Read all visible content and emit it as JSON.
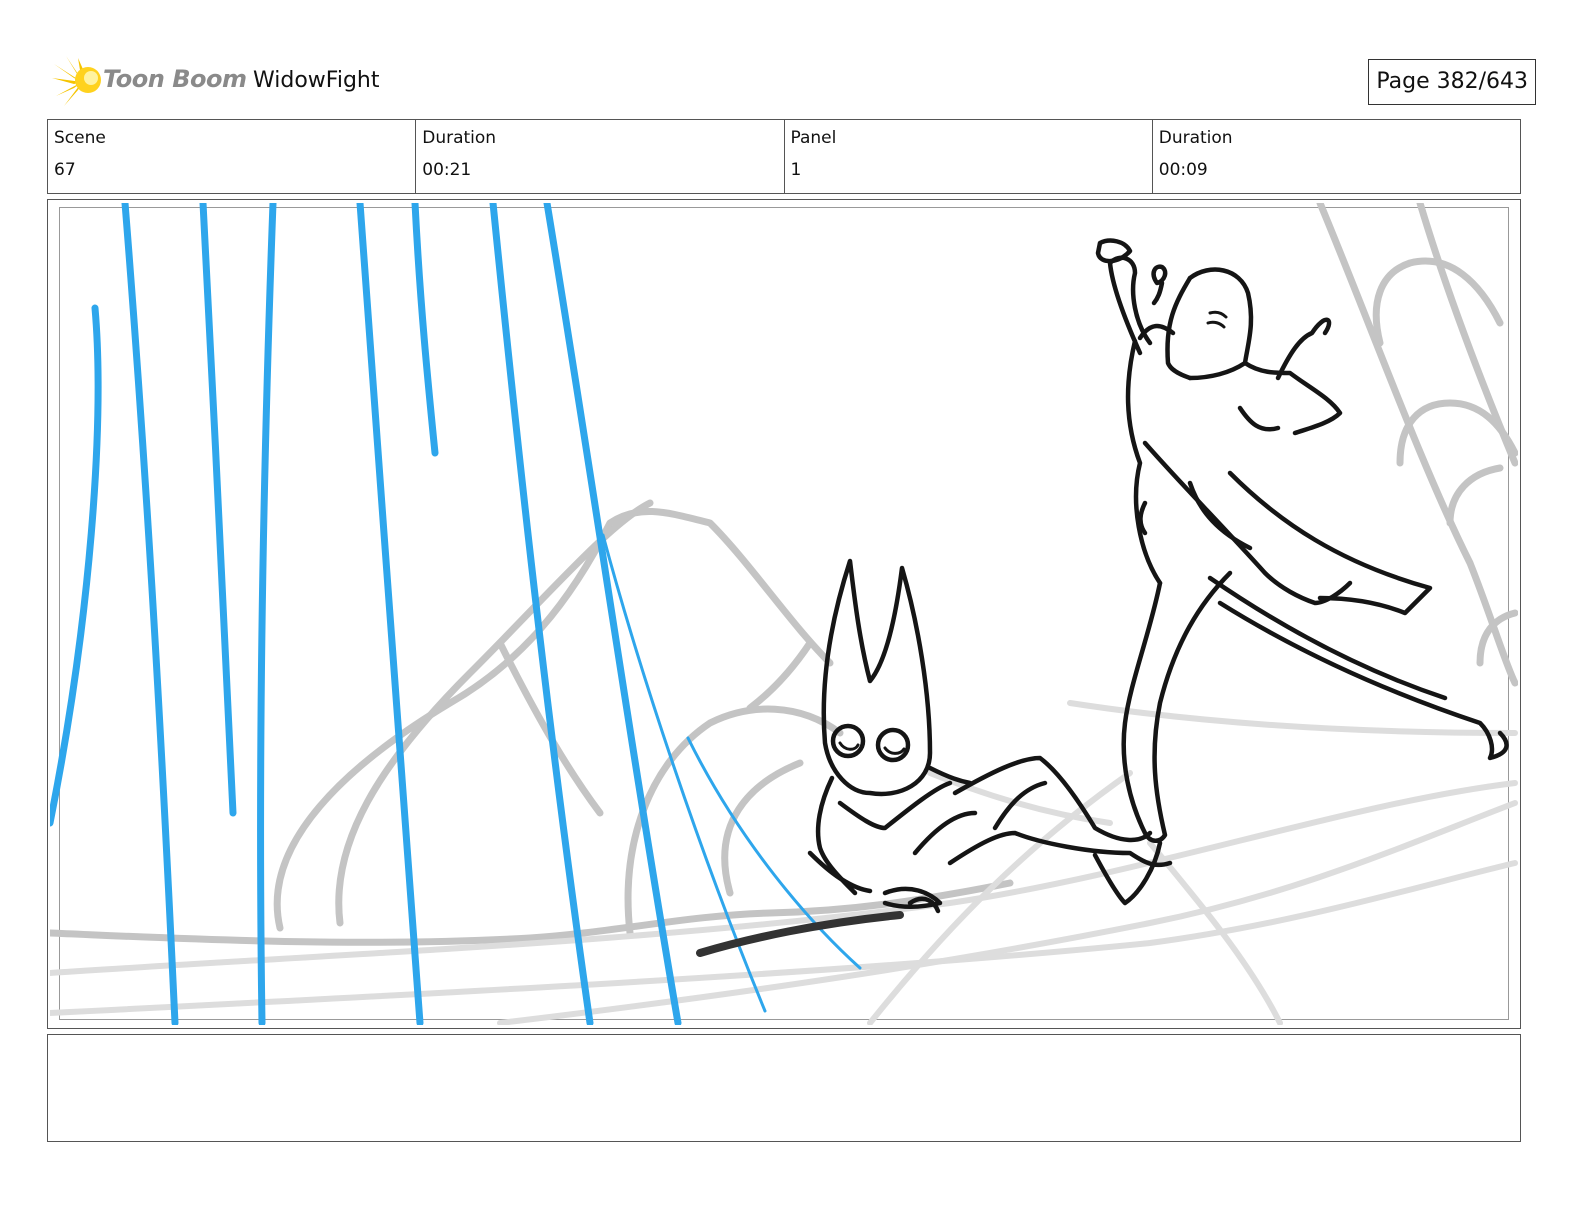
{
  "header": {
    "brand": "Toon Boom",
    "project_name": "WidowFight",
    "page_label": "Page 382/643"
  },
  "info": [
    {
      "label": "Scene",
      "value": "67"
    },
    {
      "label": "Duration",
      "value": "00:21"
    },
    {
      "label": "Panel",
      "value": "1"
    },
    {
      "label": "Duration",
      "value": "00:09"
    }
  ],
  "colors": {
    "rain": "#2ea6ec",
    "sketch_gray": "#c4c4c4",
    "ink": "#151515",
    "logo_yellow": "#f5c400"
  },
  "notes": ""
}
